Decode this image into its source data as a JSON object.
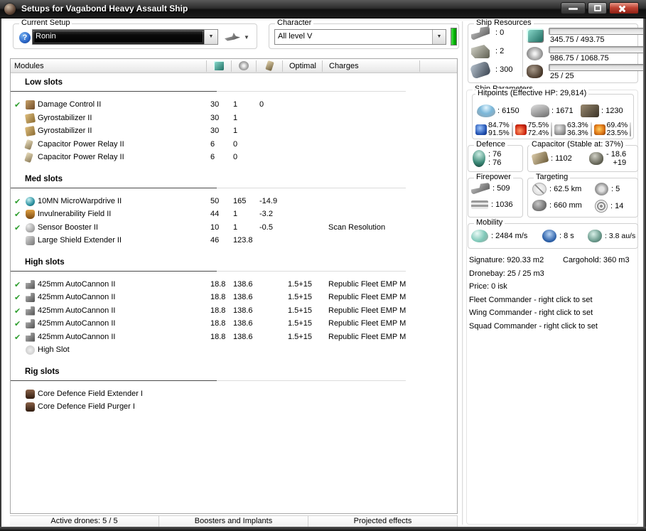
{
  "window": {
    "title": "Setups for Vagabond Heavy Assault Ship"
  },
  "setup": {
    "label": "Current Setup",
    "value": "Ronin"
  },
  "character": {
    "label": "Character",
    "value": "All level V"
  },
  "modules_table": {
    "header": {
      "modules": "Modules",
      "optimal": "Optimal",
      "charges": "Charges"
    },
    "groups": [
      {
        "name": "Low slots",
        "rows": [
          {
            "active": true,
            "icon": "damage-control",
            "name": "Damage Control II",
            "cpu": "30",
            "pg": "1",
            "cap": "0",
            "optimal": "",
            "charge": ""
          },
          {
            "active": false,
            "icon": "gyrostabilizer",
            "name": "Gyrostabilizer II",
            "cpu": "30",
            "pg": "1",
            "cap": "",
            "optimal": "",
            "charge": ""
          },
          {
            "active": false,
            "icon": "gyrostabilizer",
            "name": "Gyrostabilizer II",
            "cpu": "30",
            "pg": "1",
            "cap": "",
            "optimal": "",
            "charge": ""
          },
          {
            "active": false,
            "icon": "cap-relay",
            "name": "Capacitor Power Relay II",
            "cpu": "6",
            "pg": "0",
            "cap": "",
            "optimal": "",
            "charge": ""
          },
          {
            "active": false,
            "icon": "cap-relay",
            "name": "Capacitor Power Relay II",
            "cpu": "6",
            "pg": "0",
            "cap": "",
            "optimal": "",
            "charge": ""
          }
        ]
      },
      {
        "name": "Med slots",
        "rows": [
          {
            "active": true,
            "icon": "mwd",
            "name": "10MN MicroWarpdrive II",
            "cpu": "50",
            "pg": "165",
            "cap": "-14.9",
            "optimal": "",
            "charge": ""
          },
          {
            "active": true,
            "icon": "invuln",
            "name": "Invulnerability Field II",
            "cpu": "44",
            "pg": "1",
            "cap": "-3.2",
            "optimal": "",
            "charge": ""
          },
          {
            "active": true,
            "icon": "sensor-booster",
            "name": "Sensor Booster II",
            "cpu": "10",
            "pg": "1",
            "cap": "-0.5",
            "optimal": "",
            "charge": "Scan Resolution"
          },
          {
            "active": false,
            "icon": "shield-extender",
            "name": "Large Shield Extender II",
            "cpu": "46",
            "pg": "123.8",
            "cap": "",
            "optimal": "",
            "charge": ""
          }
        ]
      },
      {
        "name": "High slots",
        "rows": [
          {
            "active": true,
            "icon": "autocannon",
            "name": "425mm AutoCannon II",
            "cpu": "18.8",
            "pg": "138.6",
            "cap": "",
            "optimal": "1.5+15",
            "charge": "Republic Fleet EMP M"
          },
          {
            "active": true,
            "icon": "autocannon",
            "name": "425mm AutoCannon II",
            "cpu": "18.8",
            "pg": "138.6",
            "cap": "",
            "optimal": "1.5+15",
            "charge": "Republic Fleet EMP M"
          },
          {
            "active": true,
            "icon": "autocannon",
            "name": "425mm AutoCannon II",
            "cpu": "18.8",
            "pg": "138.6",
            "cap": "",
            "optimal": "1.5+15",
            "charge": "Republic Fleet EMP M"
          },
          {
            "active": true,
            "icon": "autocannon",
            "name": "425mm AutoCannon II",
            "cpu": "18.8",
            "pg": "138.6",
            "cap": "",
            "optimal": "1.5+15",
            "charge": "Republic Fleet EMP M"
          },
          {
            "active": true,
            "icon": "autocannon",
            "name": "425mm AutoCannon II",
            "cpu": "18.8",
            "pg": "138.6",
            "cap": "",
            "optimal": "1.5+15",
            "charge": "Republic Fleet EMP M"
          },
          {
            "active": false,
            "icon": "empty-high",
            "name": "High Slot",
            "cpu": "",
            "pg": "",
            "cap": "",
            "optimal": "",
            "charge": ""
          }
        ]
      },
      {
        "name": "Rig slots",
        "rows": [
          {
            "active": false,
            "icon": "rig",
            "name": "Core Defence Field Extender I",
            "cpu": "",
            "pg": "",
            "cap": "",
            "optimal": "",
            "charge": ""
          },
          {
            "active": false,
            "icon": "rig",
            "name": "Core Defence Field Purger I",
            "cpu": "",
            "pg": "",
            "cap": "",
            "optimal": "",
            "charge": ""
          }
        ]
      }
    ]
  },
  "bottom_tabs": [
    "Active drones: 5 / 5",
    "Boosters and Implants",
    "Projected effects"
  ],
  "ship_resources": {
    "title": "Ship Resources",
    "slots": [
      {
        "icon": "turret-hardpoint",
        "value": ": 0"
      },
      {
        "icon": "launcher-hardpoint",
        "value": ": 2"
      },
      {
        "icon": "calibration",
        "value": ": 300"
      }
    ],
    "bars": [
      {
        "icon": "cpu-res",
        "label": "345.75 / 493.75",
        "pct": 70
      },
      {
        "icon": "pg-res",
        "label": "986.75 / 1068.75",
        "pct": 92
      },
      {
        "icon": "calib-res",
        "label": "25 / 25",
        "pct": 100
      }
    ]
  },
  "ship_parameters": {
    "title": "Ship Parameters",
    "hitpoints": {
      "title": "Hitpoints (Effective HP: 29,814)",
      "hp": [
        {
          "icon": "shield-hp",
          "value": ": 6150"
        },
        {
          "icon": "armor-hp",
          "value": ": 1671"
        },
        {
          "icon": "structure-hp",
          "value": ": 1230"
        }
      ],
      "resists": [
        {
          "icon": "em-resist",
          "shield": "84.7%",
          "armor": "91.5%"
        },
        {
          "icon": "thermal-resist",
          "shield": "75.5%",
          "armor": "72.4%"
        },
        {
          "icon": "kinetic-resist",
          "shield": "63.3%",
          "armor": "36.3%"
        },
        {
          "icon": "explosive-resist",
          "shield": "69.4%",
          "armor": "23.5%"
        }
      ]
    },
    "defence": {
      "title": "Defence",
      "line1": ": 76",
      "line2": ": 76"
    },
    "capacitor": {
      "title": "Capacitor (Stable at: 37%)",
      "amount": ": 1102",
      "delta_neg": "- 18.6",
      "delta_pos": "+19"
    },
    "firepower": {
      "title": "Firepower",
      "volley": ": 509",
      "dps": ": 1036"
    },
    "targeting": {
      "title": "Targeting",
      "range": ": 62.5 km",
      "scan_res": ": 660 mm",
      "max_targets": ": 5",
      "sensor_str": ": 14"
    },
    "mobility": {
      "title": "Mobility",
      "speed": ": 2484 m/s",
      "align": ": 8 s",
      "warp": ": 3.8 au/s"
    },
    "info": {
      "signature": "Signature: 920.33 m2",
      "cargohold": "Cargohold: 360 m3",
      "lines": [
        "Dronebay: 25 / 25 m3",
        "Price: 0 isk",
        "Fleet Commander - right click to set",
        "Wing Commander - right click to set",
        "Squad Commander - right click to set"
      ]
    }
  },
  "colors": {
    "bar_green": "#2db82d",
    "char_bar_green": "#00b400",
    "check_green": "#2e9e2e",
    "close_button_red": "#c24434"
  }
}
